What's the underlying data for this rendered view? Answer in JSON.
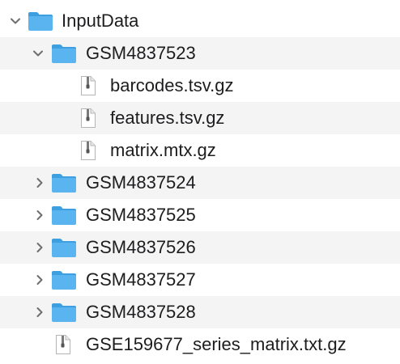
{
  "tree": {
    "root": {
      "label": "InputData",
      "expanded": true,
      "icon": "folder-icon"
    },
    "children": [
      {
        "label": "GSM4837523",
        "type": "folder",
        "expanded": true,
        "children": [
          {
            "label": "barcodes.tsv.gz",
            "type": "file"
          },
          {
            "label": "features.tsv.gz",
            "type": "file"
          },
          {
            "label": "matrix.mtx.gz",
            "type": "file"
          }
        ]
      },
      {
        "label": "GSM4837524",
        "type": "folder",
        "expanded": false
      },
      {
        "label": "GSM4837525",
        "type": "folder",
        "expanded": false
      },
      {
        "label": "GSM4837526",
        "type": "folder",
        "expanded": false
      },
      {
        "label": "GSM4837527",
        "type": "folder",
        "expanded": false
      },
      {
        "label": "GSM4837528",
        "type": "folder",
        "expanded": false
      },
      {
        "label": "GSE159677_series_matrix.txt.gz",
        "type": "file"
      }
    ]
  },
  "colors": {
    "folder_body": "#5ab4f0",
    "folder_tab": "#3d9ee0",
    "stripe": "#f4f4f4",
    "chevron": "#6e6e6e",
    "text": "#1d1d1f"
  }
}
